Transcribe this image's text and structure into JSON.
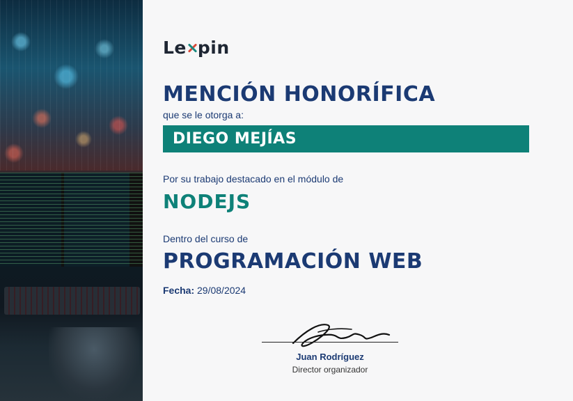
{
  "brand": {
    "logo_left": "Le",
    "logo_right": "pin",
    "logo_mark": "x-mark-icon"
  },
  "certificate": {
    "title": "MENCIÓN HONORÍFICA",
    "subtitle": "que se le otorga a:",
    "recipient": "DIEGO MEJÍAS",
    "module_label": "Por su trabajo destacado en el módulo de",
    "module": "NODEJS",
    "course_label": "Dentro del curso de",
    "course": "PROGRAMACIÓN WEB",
    "date_label": "Fecha:",
    "date_value": "29/08/2024"
  },
  "signatory": {
    "name": "Juan Rodríguez",
    "role": "Director organizador"
  },
  "colors": {
    "navy": "#1b3a73",
    "teal": "#0e8178",
    "accent_red": "#d94a3a"
  },
  "image": {
    "description_icon": "developer-workstation-photo"
  }
}
